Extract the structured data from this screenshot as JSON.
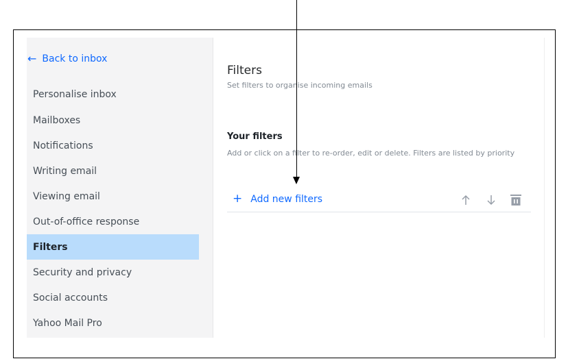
{
  "sidebar": {
    "back_label": "Back to inbox",
    "items": [
      {
        "label": "Personalise inbox",
        "active": false
      },
      {
        "label": "Mailboxes",
        "active": false
      },
      {
        "label": "Notifications",
        "active": false
      },
      {
        "label": "Writing email",
        "active": false
      },
      {
        "label": "Viewing email",
        "active": false
      },
      {
        "label": "Out-of-office response",
        "active": false
      },
      {
        "label": "Filters",
        "active": true
      },
      {
        "label": "Security and privacy",
        "active": false
      },
      {
        "label": "Social accounts",
        "active": false
      },
      {
        "label": "Yahoo Mail Pro",
        "active": false
      }
    ]
  },
  "content": {
    "title": "Filters",
    "subtitle": "Set filters to organise incoming emails",
    "section_title": "Your filters",
    "section_desc": "Add or click on a filter to re-order, edit or delete. Filters are listed by priority",
    "add_label": "Add new filters"
  },
  "icons": {
    "back": "arrow-left-icon",
    "add": "plus-icon",
    "move_up": "arrow-up-icon",
    "move_down": "arrow-down-icon",
    "delete": "trash-icon"
  },
  "colors": {
    "accent": "#0f69ff",
    "active_bg": "#b9dcfc",
    "sidebar_bg": "#f4f4f5"
  }
}
